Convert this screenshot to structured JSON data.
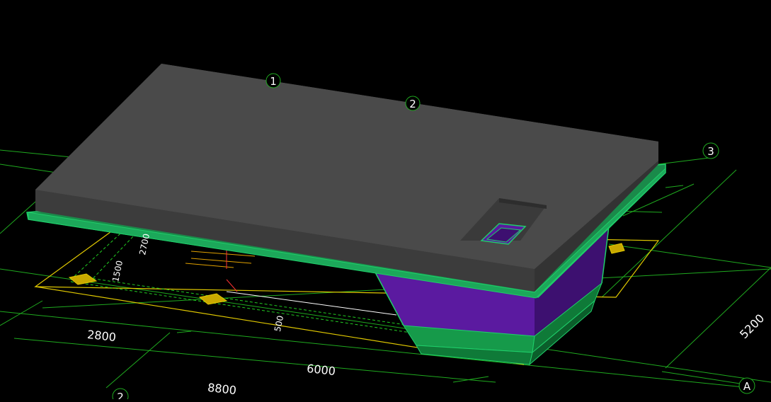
{
  "colors": {
    "background": "#000000",
    "grid_line": "#1faa1f",
    "top_slab": "#4a4a4a",
    "top_slab_side": "#3a3a3a",
    "slab_edge": "#1fcf6a",
    "pit_purple": "#5b1aa0",
    "pit_purple_dark": "#3d1070",
    "pit_green": "#169a4a",
    "footing_yellow": "#e0c800",
    "hatch_green": "#22cc22"
  },
  "axes": {
    "label_1": "1",
    "label_2": "2",
    "label_3": "3",
    "label_2_bottom": "2",
    "label_A": "A"
  },
  "dimensions": {
    "dim_2800": "2800",
    "dim_6000": "6000",
    "dim_8800": "8800",
    "dim_5200": "5200",
    "dim_1500": "1500",
    "dim_2700": "2700",
    "dim_500": "500"
  },
  "icons": {
    "axis_bubble": "circle-axis-marker-icon"
  }
}
